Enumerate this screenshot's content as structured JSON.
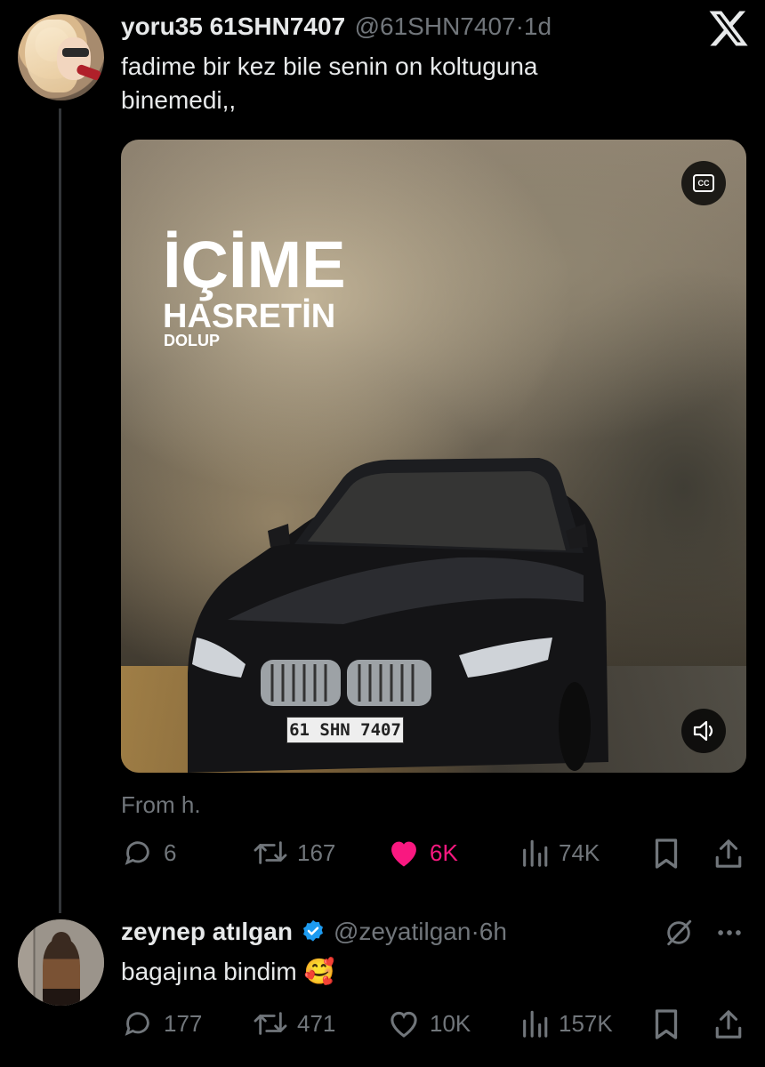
{
  "top_bar": {
    "logo_icon": "x-logo"
  },
  "tweet1": {
    "display_name": "yoru35 61SHN7407",
    "handle": "@61SHN7407",
    "separator": "·",
    "time": "1d",
    "text_line1": "fadime bir kez bile senin on koltuguna",
    "text_line2": "binemedi,,",
    "media": {
      "overlay_title": "İÇİME",
      "overlay_subtitle": "HASRETİN",
      "overlay_small": "DOLUP",
      "plate_text": "61 SHN 7407",
      "cc_label": "CC",
      "cc_icon": "closed-captions-icon",
      "volume_icon": "volume-icon"
    },
    "source_label": "From h.",
    "actions": {
      "replies": "6",
      "retweets": "167",
      "likes": "6K",
      "views": "74K"
    },
    "like_color": "#f91880"
  },
  "tweet2": {
    "display_name": "zeynep atılgan",
    "verified_icon": "verified-badge-icon",
    "handle": "@zeyatilgan",
    "separator": "·",
    "time": "6h",
    "text": "bagajına bindim",
    "emoji": "🥰",
    "actions": {
      "replies": "177",
      "retweets": "471",
      "likes": "10K",
      "views": "157K"
    }
  },
  "colors": {
    "background": "#000000",
    "primary_text": "#e7e9ea",
    "secondary_text": "#71767b",
    "verified": "#1d9bf0"
  }
}
